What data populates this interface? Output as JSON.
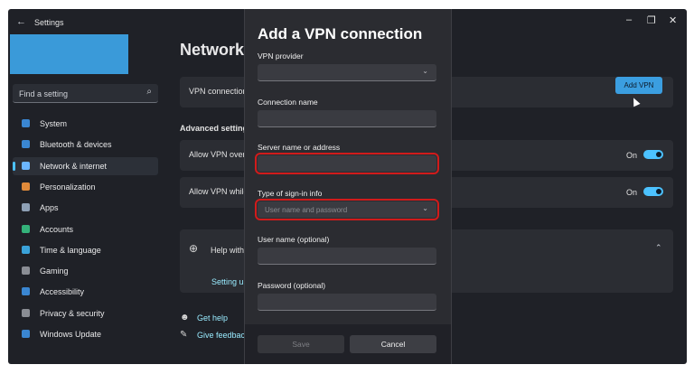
{
  "window": {
    "title": "Settings",
    "controls": [
      "–",
      "❐",
      "✕"
    ]
  },
  "sidebar": {
    "search_placeholder": "Find a setting",
    "items": [
      {
        "label": "System",
        "icon": "monitor-icon",
        "color": "#3a86d1"
      },
      {
        "label": "Bluetooth & devices",
        "icon": "bluetooth-icon",
        "color": "#3a86d1"
      },
      {
        "label": "Network & internet",
        "icon": "wifi-icon",
        "color": "#6bb6ff",
        "active": true
      },
      {
        "label": "Personalization",
        "icon": "brush-icon",
        "color": "#e08a3a"
      },
      {
        "label": "Apps",
        "icon": "apps-icon",
        "color": "#8ea0b5"
      },
      {
        "label": "Accounts",
        "icon": "person-icon",
        "color": "#34b27a"
      },
      {
        "label": "Time & language",
        "icon": "globe-clock-icon",
        "color": "#3aa2d9"
      },
      {
        "label": "Gaming",
        "icon": "controller-icon",
        "color": "#8a8d94"
      },
      {
        "label": "Accessibility",
        "icon": "accessibility-icon",
        "color": "#3a86d1"
      },
      {
        "label": "Privacy & security",
        "icon": "shield-icon",
        "color": "#8a8d94"
      },
      {
        "label": "Windows Update",
        "icon": "update-icon",
        "color": "#3a86d1"
      }
    ]
  },
  "main": {
    "title": "Network &",
    "vpn_connections_label": "VPN connections",
    "add_vpn_label": "Add VPN",
    "advanced_label": "Advanced settings",
    "allow_vpn_metered": "Allow VPN over m",
    "allow_vpn_roaming": "Allow VPN while",
    "toggle_on_label": "On",
    "help_label": "Help with",
    "setting_up_label": "Setting up",
    "get_help": "Get help",
    "give_feedback": "Give feedback"
  },
  "dialog": {
    "title": "Add a VPN connection",
    "fields": {
      "vpn_provider_label": "VPN provider",
      "connection_name_label": "Connection name",
      "server_label": "Server name or address",
      "signin_type_label": "Type of sign-in info",
      "signin_type_value": "User name and password",
      "username_label": "User name (optional)",
      "password_label": "Password (optional)"
    },
    "save_label": "Save",
    "cancel_label": "Cancel"
  },
  "colors": {
    "accent": "#4cc2ff",
    "highlight": "#d11b1b",
    "add_button": "#3b9ee0"
  }
}
